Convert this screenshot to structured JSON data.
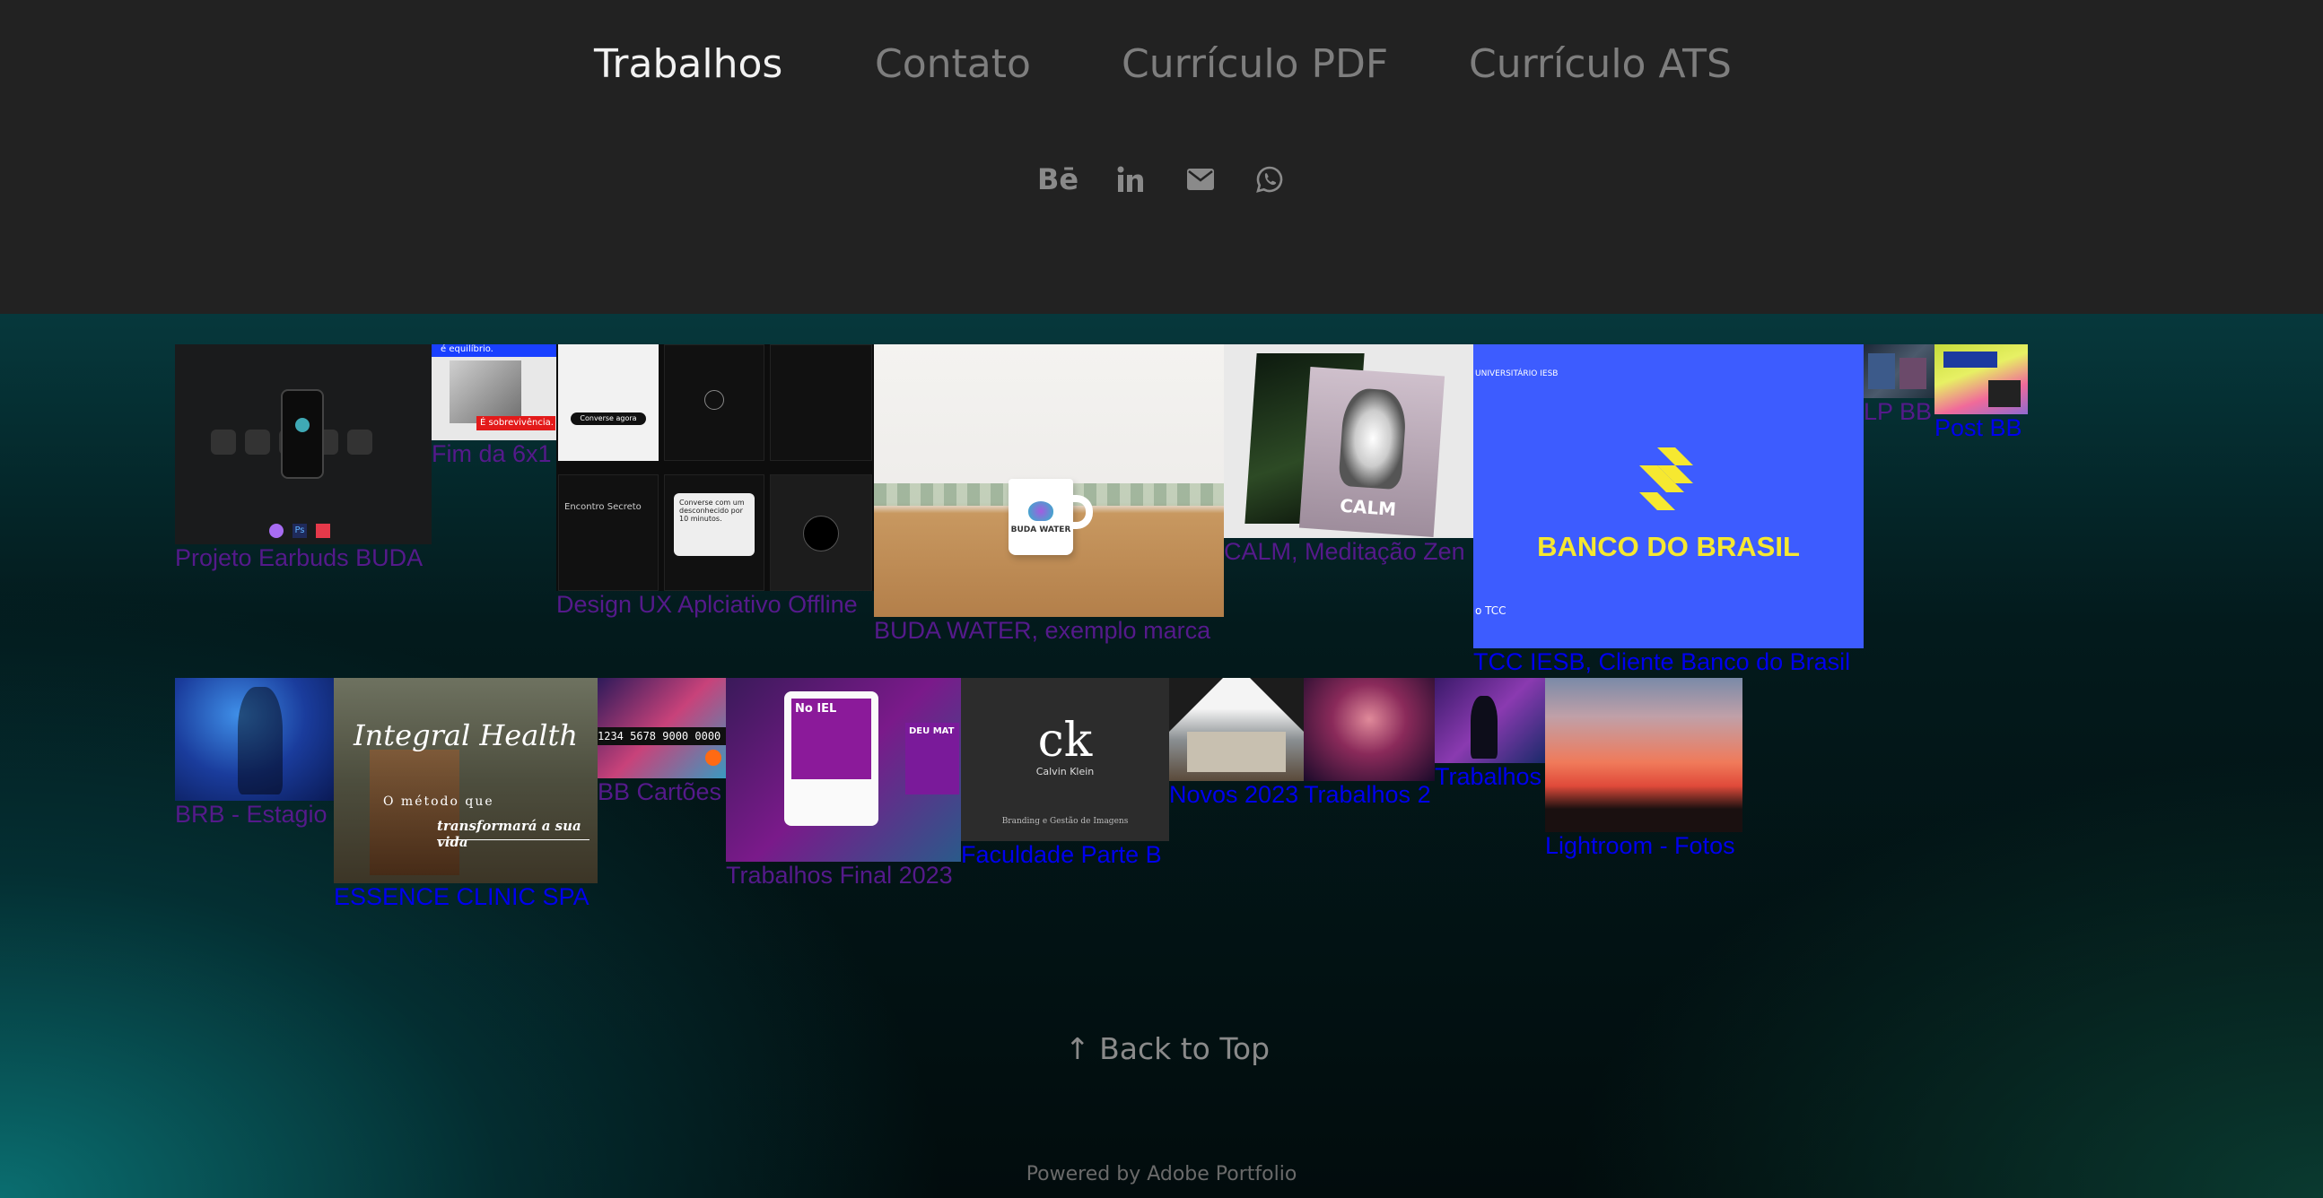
{
  "nav": {
    "trabalhos": "Trabalhos",
    "contato": "Contato",
    "curriculo_pdf": "Currículo PDF",
    "curriculo_ats": "Currículo ATS"
  },
  "social": {
    "behance": "Bē",
    "icons": [
      "behance-icon",
      "linkedin-icon",
      "email-icon",
      "whatsapp-icon"
    ]
  },
  "projects": [
    {
      "title": "Projeto Earbuds BUDA"
    },
    {
      "title": "Fim da 6x1",
      "thumb_text": [
        "é equilíbrio.",
        "É sobrevivência."
      ]
    },
    {
      "title": "Design UX Aplciativo Offline",
      "thumb_text": [
        "Converse agora",
        "Encontro Secreto",
        "Converse com um desconhecido por 10 minutos."
      ]
    },
    {
      "title": "BUDA WATER, exemplo marca",
      "thumb_text": [
        "BUDA WATER"
      ]
    },
    {
      "title": "CALM, Meditação Zen",
      "thumb_text": [
        "CALM"
      ]
    },
    {
      "title": "TCC IESB, Cliente Banco do Brasil",
      "thumb_text": [
        "UNIVERSITÁRIO IESB",
        "BANCO DO BRASIL",
        "o TCC"
      ]
    },
    {
      "title": "LP BB"
    },
    {
      "title": "Post BB"
    },
    {
      "title": "BRB - Estagio"
    },
    {
      "title": "ESSENCE CLINIC SPA",
      "thumb_text": [
        "Integral Health",
        "O método que",
        "transformará a sua vida"
      ]
    },
    {
      "title": "BB Cartões",
      "thumb_text": [
        "1234 5678 9000 0000"
      ]
    },
    {
      "title": "Trabalhos Final 2023",
      "thumb_text": [
        "No IEL",
        "DEU MAT"
      ]
    },
    {
      "title": "Faculdade Parte B",
      "thumb_text": [
        "Calvin Klein",
        "Branding e Gestão de Imagens"
      ]
    },
    {
      "title": "Novos 2023"
    },
    {
      "title": "Trabalhos 2"
    },
    {
      "title": "Trabalhos"
    },
    {
      "title": "Lightroom - Fotos"
    }
  ],
  "colors": {
    "header_bg": "#222222",
    "nav_active": "#f2f2f2",
    "nav_inactive": "#7e7e7e",
    "link_unvisited": "#0000ee",
    "link_visited": "#551a8b",
    "bb_blue": "#3d5cff",
    "bb_yellow": "#f6e830"
  },
  "footer": {
    "back_to_top": "↑ Back to Top",
    "powered_by": "Powered by Adobe Portfolio"
  }
}
